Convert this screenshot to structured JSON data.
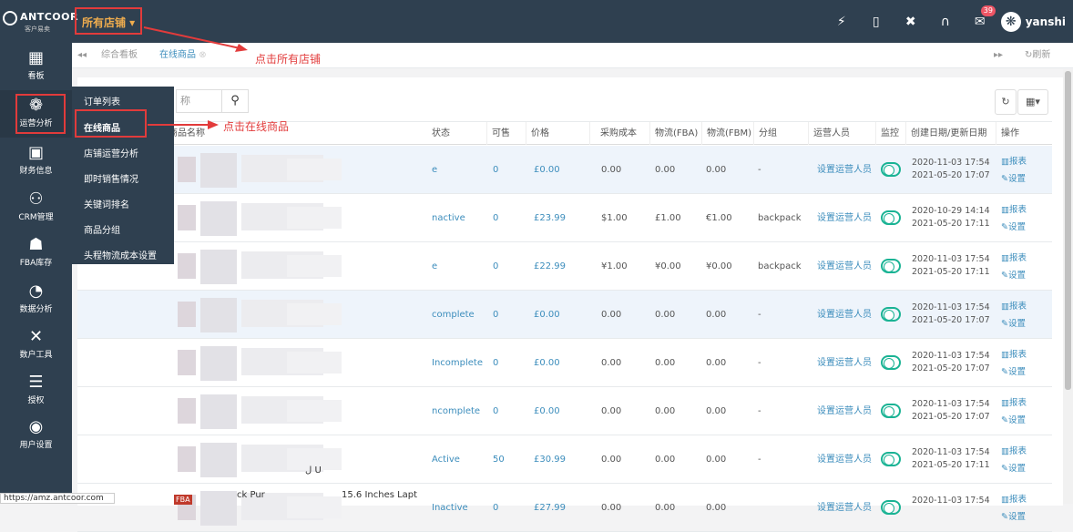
{
  "header": {
    "logo_text": "ANTCOOR",
    "logo_sub": "客户易卖",
    "store_selector": "所有店铺 ▾",
    "mail_badge": "39",
    "username": "yanshi",
    "icons": [
      "plug-icon",
      "mobile-icon",
      "expand-icon",
      "headset-icon",
      "mail-icon"
    ]
  },
  "sidebar": {
    "items": [
      {
        "icon": "dashboard-icon",
        "label": "看板"
      },
      {
        "icon": "operations-icon",
        "label": "运营分析"
      },
      {
        "icon": "finance-icon",
        "label": "财务信息"
      },
      {
        "icon": "crm-icon",
        "label": "CRM管理"
      },
      {
        "icon": "fba-icon",
        "label": "FBA库存"
      },
      {
        "icon": "data-analysis-icon",
        "label": "数据分析"
      },
      {
        "icon": "tools-icon",
        "label": "数户工具"
      },
      {
        "icon": "authorize-icon",
        "label": "授权"
      },
      {
        "icon": "user-settings-icon",
        "label": "用户设置"
      }
    ]
  },
  "submenu": {
    "items": [
      "订单列表",
      "在线商品",
      "店铺运营分析",
      "即时销售情况",
      "关键词排名",
      "商品分组",
      "头程物流成本设置"
    ]
  },
  "tabs": {
    "items": [
      "综合看板",
      "在线商品"
    ],
    "refresh_label": "刷新"
  },
  "annotations": {
    "store": "点击所有店铺",
    "online_products": "点击在线商品"
  },
  "search": {
    "placeholder": "称"
  },
  "table": {
    "columns": [
      "商品名称",
      "状态",
      "可售",
      "价格",
      "采购成本",
      "物流(FBA)",
      "物流(FBM)",
      "分组",
      "运营人员",
      "监控",
      "创建日期/更新日期",
      "操作"
    ],
    "rows": [
      {
        "status": "e",
        "available": "0",
        "price": "£0.00",
        "cost": "0.00",
        "fba": "0.00",
        "fbm": "0.00",
        "group": "-",
        "operator": "设置运营人员",
        "created": "2020-11-03 17:54",
        "updated": "2021-05-20 17:07",
        "highlight": true
      },
      {
        "status": "nactive",
        "available": "0",
        "price": "£23.99",
        "cost": "$1.00",
        "fba": "£1.00",
        "fbm": "€1.00",
        "group": "backpack",
        "operator": "设置运营人员",
        "created": "2020-10-29 14:14",
        "updated": "2021-05-20 17:11",
        "highlight": false
      },
      {
        "status": "e",
        "available": "0",
        "price": "£22.99",
        "cost": "¥1.00",
        "fba": "¥0.00",
        "fbm": "¥0.00",
        "group": "backpack",
        "operator": "设置运营人员",
        "created": "2020-11-03 17:54",
        "updated": "2021-05-20 17:11",
        "highlight": false
      },
      {
        "status": "complete",
        "available": "0",
        "price": "£0.00",
        "cost": "0.00",
        "fba": "0.00",
        "fbm": "0.00",
        "group": "-",
        "operator": "设置运营人员",
        "created": "2020-11-03 17:54",
        "updated": "2021-05-20 17:07",
        "highlight": true
      },
      {
        "status": "Incomplete",
        "available": "0",
        "price": "£0.00",
        "cost": "0.00",
        "fba": "0.00",
        "fbm": "0.00",
        "group": "-",
        "operator": "设置运营人员",
        "created": "2020-11-03 17:54",
        "updated": "2021-05-20 17:07",
        "highlight": false
      },
      {
        "status": "ncomplete",
        "available": "0",
        "price": "£0.00",
        "cost": "0.00",
        "fba": "0.00",
        "fbm": "0.00",
        "group": "-",
        "operator": "设置运营人员",
        "created": "2020-11-03 17:54",
        "updated": "2021-05-20 17:07",
        "highlight": false
      },
      {
        "status": "Active",
        "available": "50",
        "price": "£30.99",
        "cost": "0.00",
        "fba": "0.00",
        "fbm": "0.00",
        "group": "-",
        "operator": "设置运营人员",
        "created": "2020-11-03 17:54",
        "updated": "2021-05-20 17:11",
        "highlight": false
      },
      {
        "status": "Inactive",
        "available": "0",
        "price": "£27.99",
        "cost": "0.00",
        "fba": "0.00",
        "fbm": "0.00",
        "group": "",
        "operator": "设置运营人员",
        "created": "2020-11-03 17:54",
        "updated": "",
        "highlight": false
      }
    ],
    "report_label": "报表",
    "settings_label": "设置",
    "partial_title_fragment": "ck Pur",
    "partial_title_fragment2": "15.6 Inches Lapt",
    "fba_tag": "FBA",
    "text_fragment": "ل U"
  },
  "status_bar": {
    "url": "https://amz.antcoor.com"
  }
}
